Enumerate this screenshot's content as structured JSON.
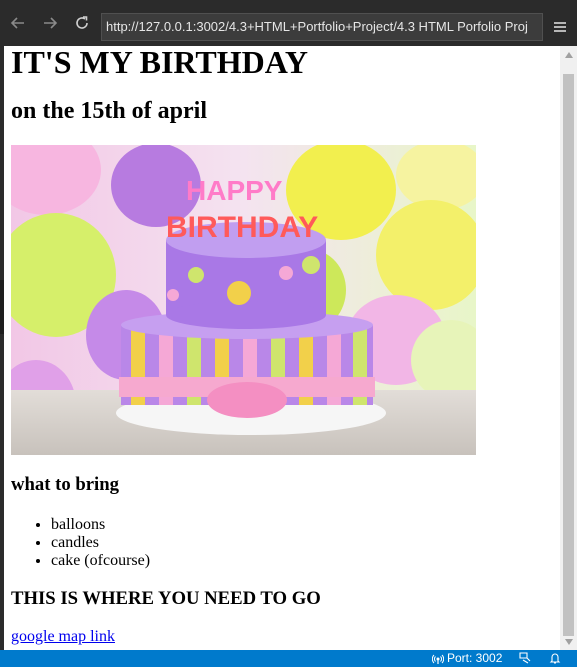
{
  "browser": {
    "url": "http://127.0.0.1:3002/4.3+HTML+Portfolio+Project/4.3 HTML Porfolio Proj"
  },
  "page": {
    "title": "IT'S MY BIRTHDAY",
    "subtitle": "on the 15th of april",
    "image_alt": "birthday cake",
    "bring_heading": "what to bring",
    "items": [
      "balloons",
      "candles",
      "cake (ofcourse)"
    ],
    "where_heading": "THIS IS WHERE YOU NEED TO GO",
    "map_link": "google map link"
  },
  "statusbar": {
    "port_label": "Port: 3002"
  },
  "colors": {
    "toolbar": "#2b2b2b",
    "status": "#007acc",
    "link": "#0000ee"
  }
}
